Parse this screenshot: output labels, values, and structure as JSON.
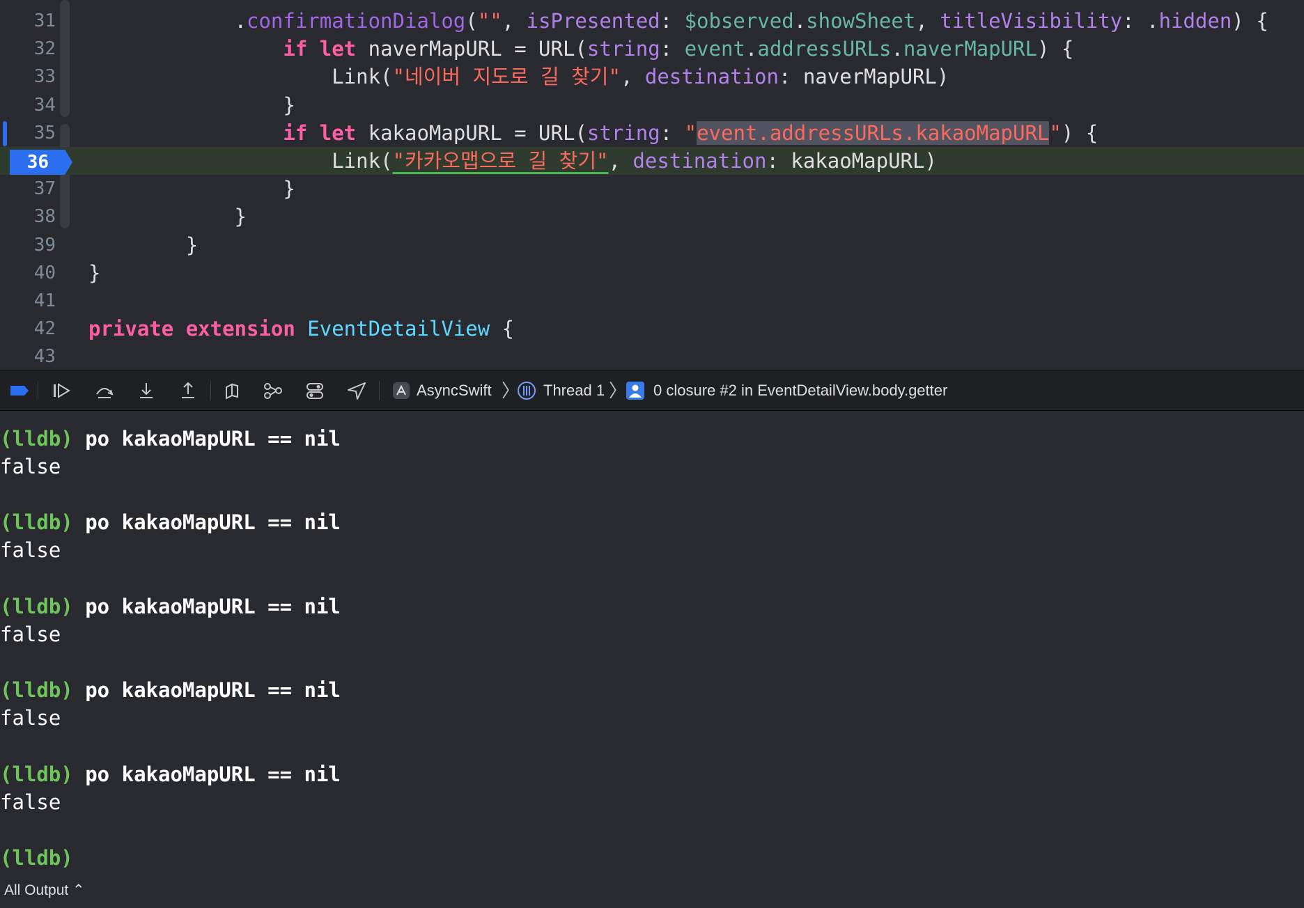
{
  "editor": {
    "lines": [
      {
        "num": "31",
        "html": "            <span class='plain'>.</span><span class='fn'>confirmationDialog</span><span class='plain'>(</span><span class='str'>\"\"</span><span class='plain'>, </span><span class='param'>isPresented</span><span class='plain'>: </span><span class='prop'>$observed</span><span class='plain'>.</span><span class='prop'>showSheet</span><span class='plain'>, </span><span class='param'>titleVisibility</span><span class='plain'>: .</span><span class='param'>hidden</span><span class='plain'>) {</span>"
      },
      {
        "num": "32",
        "html": "                <span class='kw'>if</span> <span class='kw'>let</span> <span class='plain'>naverMapURL = </span><span class='plain'>URL</span><span class='plain'>(</span><span class='param'>string</span><span class='plain'>: </span><span class='prop'>event</span><span class='plain'>.</span><span class='prop'>addressURLs</span><span class='plain'>.</span><span class='prop'>naverMapURL</span><span class='plain'>) {</span>"
      },
      {
        "num": "33",
        "html": "                    <span class='plain'>Link</span><span class='plain'>(</span><span class='str'>\"네이버 지도로 길 찾기\"</span><span class='plain'>, </span><span class='param'>destination</span><span class='plain'>: naverMapURL)</span>"
      },
      {
        "num": "34",
        "html": "                <span class='plain'>}</span>"
      },
      {
        "num": "35",
        "html": "                <span class='kw'>if</span> <span class='kw'>let</span> <span class='plain'>kakaoMapURL = </span><span class='plain'>URL</span><span class='plain'>(</span><span class='param'>string</span><span class='plain'>: </span><span class='str'>\"<span class='sel'>event.addressURLs.kakaoMapURL</span>\"</span><span class='plain'>) {</span>"
      },
      {
        "num": "36",
        "html": "                    <span class='plain'>Link</span><span class='plain'>(</span><span class='str ul'>\"카카오맵으로 길 찾기\"</span><span class='plain'>, </span><span class='param'>destination</span><span class='plain'>: kakaoMapURL)</span>"
      },
      {
        "num": "37",
        "html": "                <span class='plain'>}</span>"
      },
      {
        "num": "38",
        "html": "            <span class='plain'>}</span>"
      },
      {
        "num": "39",
        "html": "        <span class='plain'>}</span>"
      },
      {
        "num": "40",
        "html": "<span class='plain'>}</span>"
      },
      {
        "num": "41",
        "html": ""
      },
      {
        "num": "42",
        "html": "<span class='kw'>private</span> <span class='kw'>extension</span> <span class='ty'>EventDetailView</span> <span class='plain'>{</span>"
      },
      {
        "num": "43",
        "html": ""
      }
    ],
    "current_line": "36",
    "breakpoint_line": "35"
  },
  "debugbar": {
    "breakpoints_toggle": "breakpoints",
    "buttons": [
      "continue",
      "step-over",
      "step-into",
      "step-out",
      "view-hierarchy",
      "memory-graph",
      "environment",
      "location"
    ],
    "target": "AsyncSwift",
    "thread": "Thread 1",
    "frame": "0 closure #2 in EventDetailView.body.getter"
  },
  "console": {
    "entries": [
      {
        "prompt": "(lldb)",
        "command": " po kakaoMapURL == nil",
        "output": "false"
      },
      {
        "prompt": "(lldb)",
        "command": " po kakaoMapURL == nil",
        "output": "false"
      },
      {
        "prompt": "(lldb)",
        "command": " po kakaoMapURL == nil",
        "output": "false"
      },
      {
        "prompt": "(lldb)",
        "command": " po kakaoMapURL == nil",
        "output": "false"
      },
      {
        "prompt": "(lldb)",
        "command": " po kakaoMapURL == nil",
        "output": "false"
      }
    ],
    "final_prompt": "(lldb)",
    "output_filter": "All Output ⌃"
  }
}
